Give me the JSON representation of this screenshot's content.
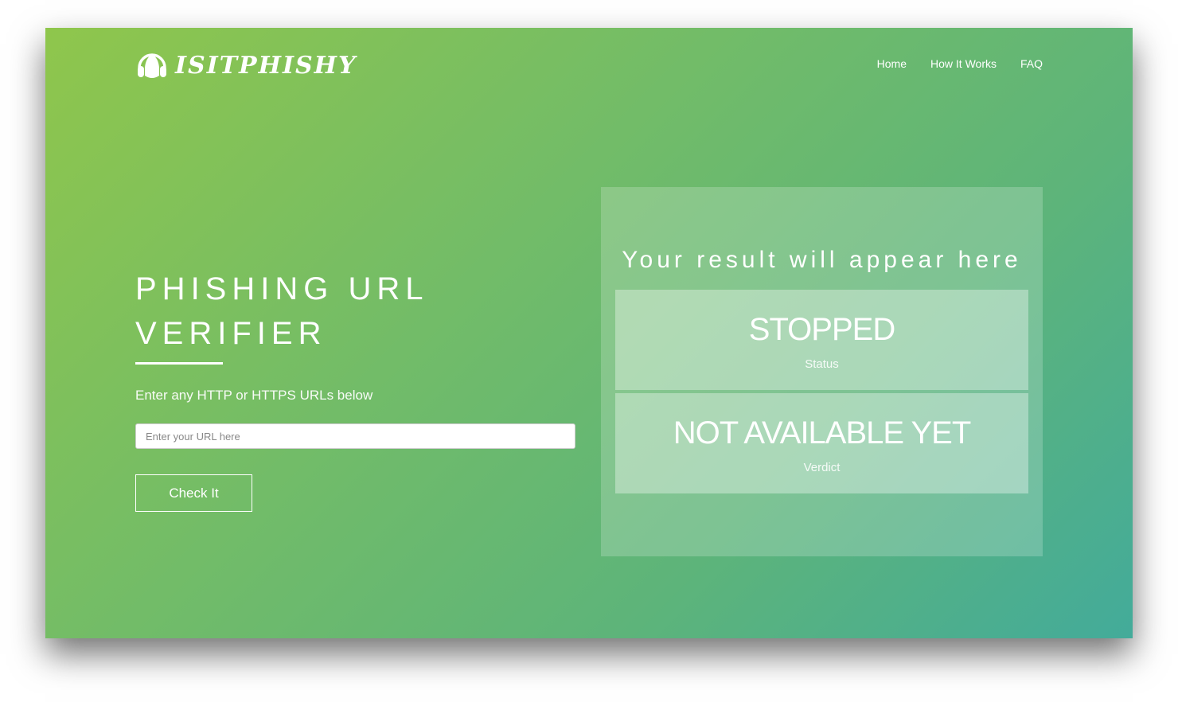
{
  "brand": {
    "name": "ISITPHISHY",
    "icon": "headphones-icon"
  },
  "nav": [
    {
      "label": "Home"
    },
    {
      "label": "How It Works"
    },
    {
      "label": "FAQ"
    }
  ],
  "hero": {
    "title_line1": "PHISHING URL",
    "title_line2": "VERIFIER",
    "subtitle": "Enter any HTTP or HTTPS URLs below",
    "url_placeholder": "Enter your URL here",
    "url_value": "",
    "button": "Check It"
  },
  "result": {
    "title": "Your result will appear here",
    "status": {
      "value": "STOPPED",
      "label": "Status"
    },
    "verdict": {
      "value": "NOT AVAILABLE YET",
      "label": "Verdict"
    }
  },
  "colors": {
    "gradient_start": "#8fc64c",
    "gradient_end": "#43ab9a"
  }
}
